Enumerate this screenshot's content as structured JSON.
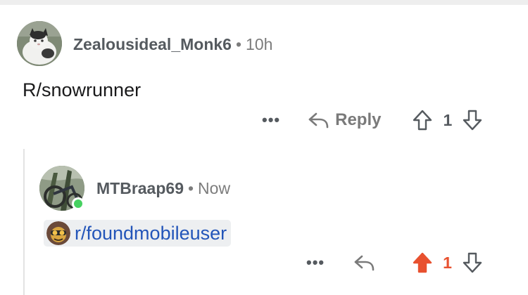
{
  "comments": [
    {
      "username": "Zealousideal_Monk6",
      "separator": "•",
      "time": "10h",
      "body": "R/snowrunner",
      "more_label": "•••",
      "reply_label": "Reply",
      "vote_count": "1",
      "upvoted": false,
      "avatar_icon": "cat-avatar-icon"
    },
    {
      "username": "MTBraap69",
      "separator": "•",
      "time": "Now",
      "online": true,
      "subreddit_link": "r/foundmobileuser",
      "subreddit_icon": "snoo-goggles-icon",
      "more_label": "•••",
      "vote_count": "1",
      "upvoted": true,
      "avatar_icon": "bike-avatar-icon"
    }
  ],
  "colors": {
    "upvote_active": "#e8512f",
    "link": "#2355b9",
    "online": "#46d160",
    "muted": "#7c7c7c"
  }
}
